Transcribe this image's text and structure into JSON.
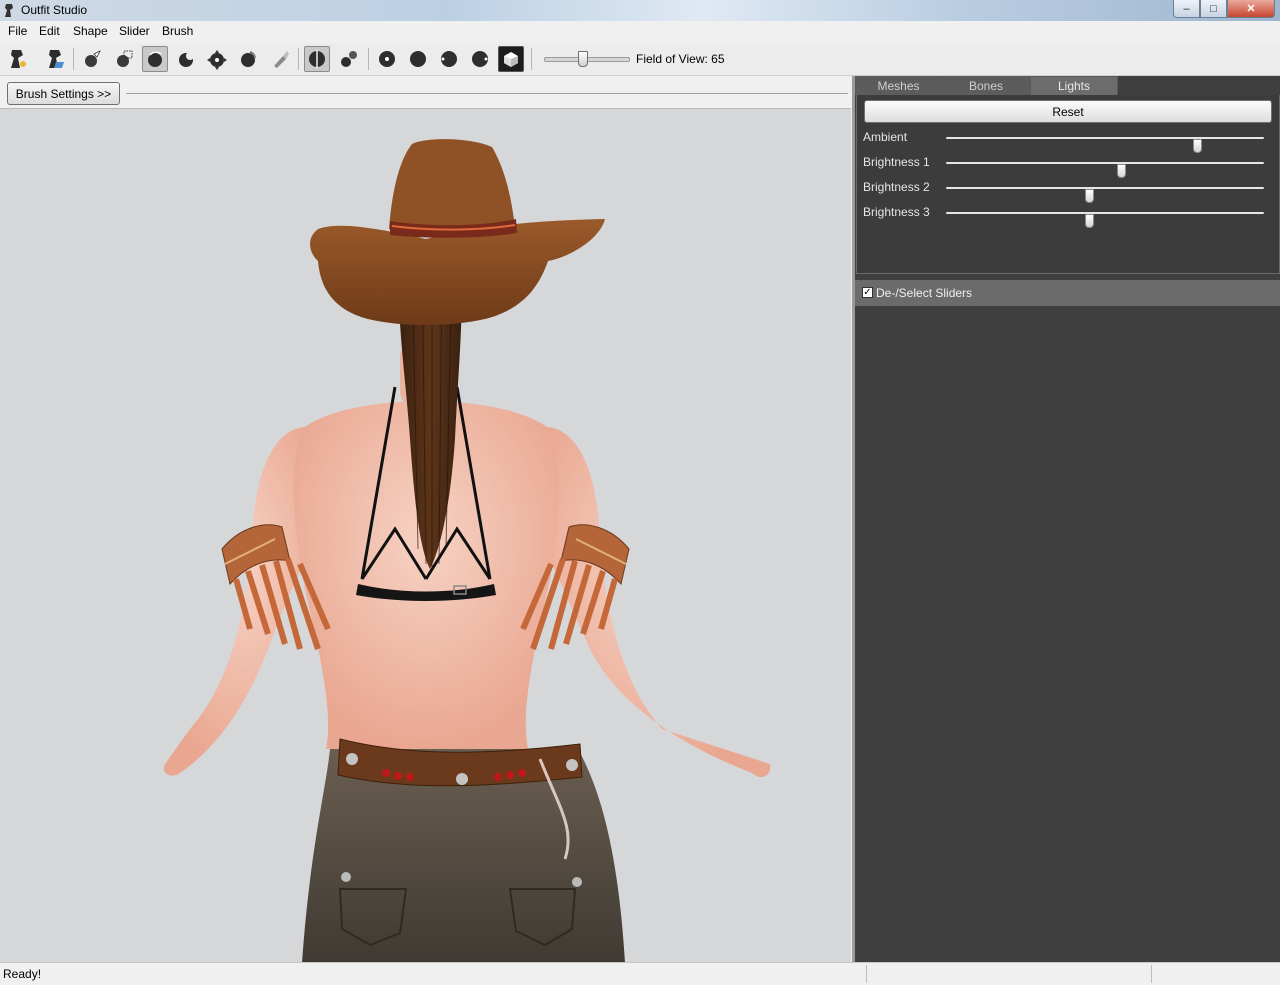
{
  "window": {
    "title": "Outfit Studio",
    "controls": {
      "minimize": "–",
      "maximize": "□",
      "close": "✕"
    }
  },
  "menu": [
    "File",
    "Edit",
    "Shape",
    "Slider",
    "Brush"
  ],
  "toolbar": {
    "tools": [
      "new-project-icon",
      "load-project-icon",
      "select-brush-icon",
      "mask-brush-icon",
      "inflate-brush-icon",
      "deflate-brush-icon",
      "move-brush-icon",
      "smooth-brush-icon",
      "weight-brush-icon",
      "mirror-icon",
      "connected-icon",
      "front-view-icon",
      "back-view-icon",
      "left-view-icon",
      "right-view-icon",
      "perspective-view-icon"
    ],
    "field_of_view": 65,
    "field_of_view_label": "Field of View: 65"
  },
  "left_panel": {
    "brush_settings_label": "Brush Settings >>"
  },
  "right_panel": {
    "tabs": [
      "Meshes",
      "Bones",
      "Lights"
    ],
    "active_tab": "Lights",
    "reset_label": "Reset",
    "lights": [
      {
        "label": "Ambient",
        "value": 0.79
      },
      {
        "label": "Brightness 1",
        "value": 0.55
      },
      {
        "label": "Brightness 2",
        "value": 0.45
      },
      {
        "label": "Brightness 3",
        "value": 0.45
      }
    ],
    "slider_toggle_label": "De-/Select Sliders",
    "slider_toggle_checked": "✓"
  },
  "status": {
    "text": "Ready!"
  },
  "colors": {
    "panel_dark": "#3f3f3f",
    "viewport_bg": "#d6d7d9",
    "skin": "#f2c1b0",
    "hat": "#8a4e23",
    "hair": "#4a2a16",
    "jeans": "#5e5447",
    "fringe": "#c4683a"
  }
}
